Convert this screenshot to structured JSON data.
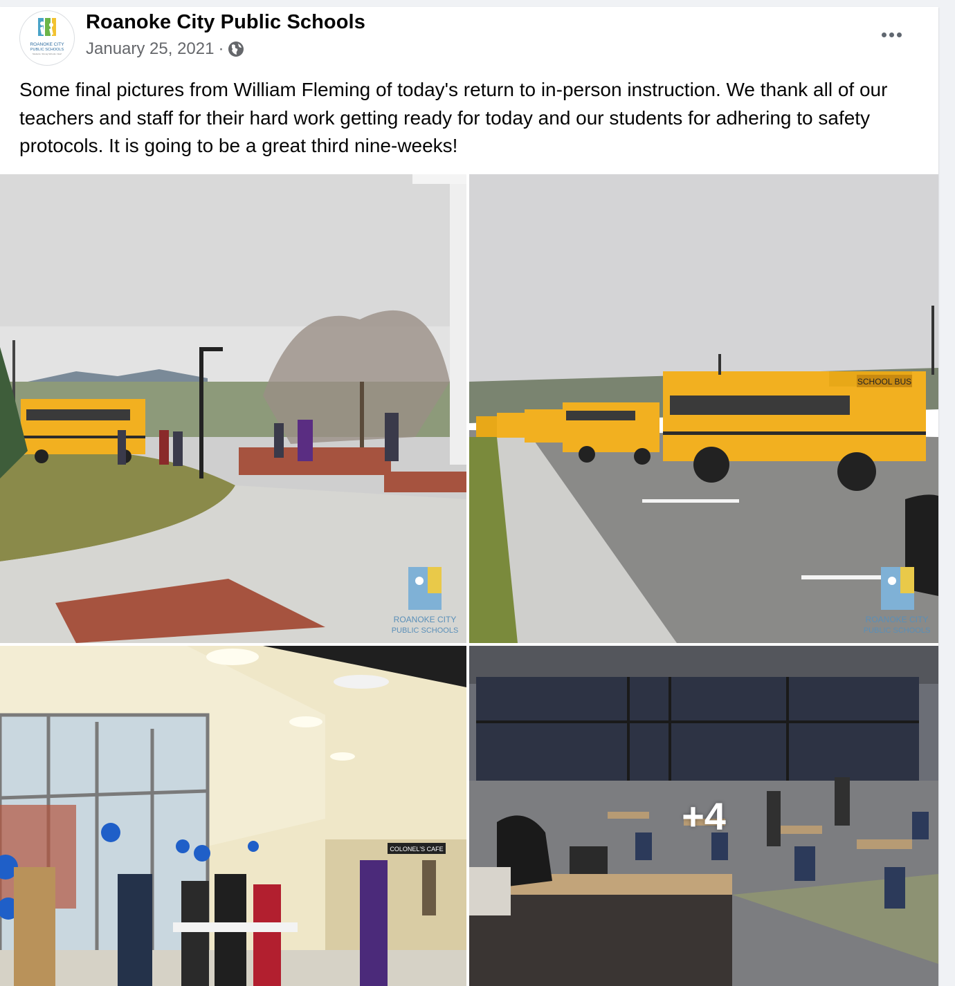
{
  "post": {
    "page_name": "Roanoke City Public Schools",
    "date": "January 25, 2021",
    "separator": "·",
    "privacy_icon": "globe-icon",
    "menu_icon": "more-horizontal-icon",
    "caption": "Some final pictures from William Fleming of today's return to in-person instruction.  We thank all of our teachers and staff for their hard work getting ready for today and our students for adhering to safety protocols. It is going to be a great third nine-weeks!"
  },
  "avatar": {
    "logo_line1": "ROANOKE CITY",
    "logo_line2": "PUBLIC SCHOOLS",
    "tagline": "Students. Strong Schools. Now!"
  },
  "photos": {
    "watermark_line1": "ROANOKE CITY",
    "watermark_line2": "PUBLIC SCHOOLS",
    "bus_sign": "SCHOOL BUS",
    "cafe_sign": "COLONEL'S CAFE",
    "more_count": "+4"
  },
  "colors": {
    "bus_yellow": "#f2b020",
    "sky": "#dcdcdc",
    "brick": "#a6533f",
    "accent_blue": "#1877f2"
  }
}
